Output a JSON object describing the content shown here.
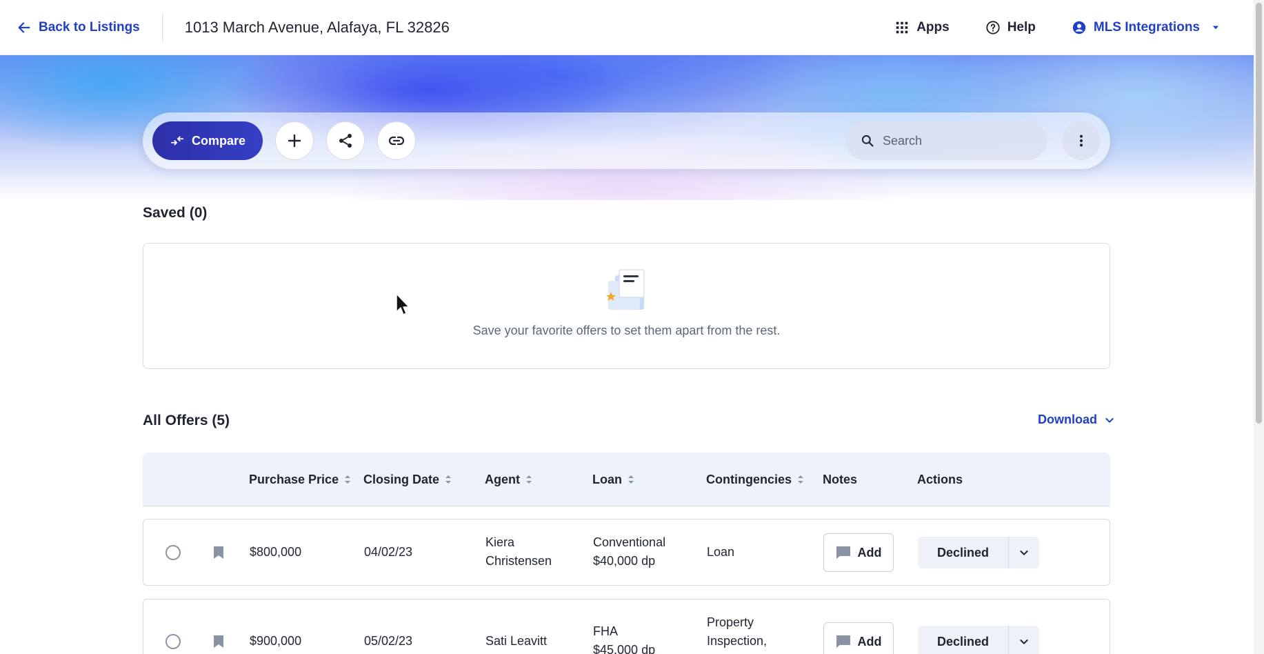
{
  "header": {
    "back_label": "Back to Listings",
    "address": "1013 March Avenue, Alafaya, FL 32826",
    "apps_label": "Apps",
    "help_label": "Help",
    "account_label": "MLS Integrations"
  },
  "toolbar": {
    "compare_label": "Compare",
    "search_placeholder": "Search"
  },
  "saved": {
    "title": "Saved (0)",
    "empty_message": "Save your favorite offers to set them apart from the rest."
  },
  "offers": {
    "title": "All Offers (5)",
    "download_label": "Download",
    "columns": {
      "price": "Purchase Price",
      "closing": "Closing Date",
      "agent": "Agent",
      "loan": "Loan",
      "contingencies": "Contingencies",
      "notes": "Notes",
      "actions": "Actions"
    },
    "rows": [
      {
        "price": "$800,000",
        "closing": "04/02/23",
        "agent_line1": "Kiera",
        "agent_line2": "Christensen",
        "loan_line1": "Conventional",
        "loan_line2": "$40,000 dp",
        "contingencies_line1": "Loan",
        "contingencies_line2": "",
        "notes_label": "Add",
        "status": "Declined"
      },
      {
        "price": "$900,000",
        "closing": "05/02/23",
        "agent_line1": "Sati Leavitt",
        "agent_line2": "",
        "loan_line1": "FHA",
        "loan_line2": "$45,000 dp",
        "contingencies_line1": "Property",
        "contingencies_line2": "Inspection,",
        "notes_label": "Add",
        "status": "Declined"
      }
    ]
  },
  "colors": {
    "accent": "#1f3fc7",
    "compare_bg": "#2d2fa8",
    "table_head_bg": "#eef3fb",
    "status_bg": "#eef1f7"
  }
}
